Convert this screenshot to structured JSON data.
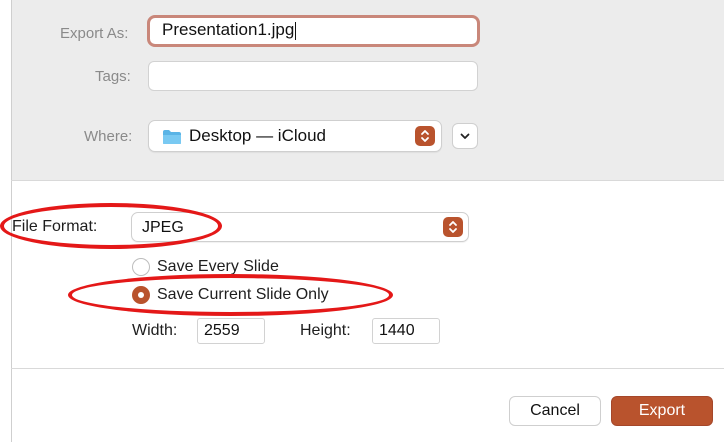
{
  "export_as": {
    "label": "Export As:",
    "value": "Presentation1.jpg"
  },
  "tags": {
    "label": "Tags:",
    "value": ""
  },
  "where": {
    "label": "Where:",
    "value": "Desktop — iCloud"
  },
  "file_format": {
    "label": "File Format:",
    "value": "JPEG"
  },
  "options": {
    "save_every": "Save Every Slide",
    "save_current": "Save Current Slide Only",
    "selected": "save_current"
  },
  "dimensions": {
    "width_label": "Width:",
    "width_value": "2559",
    "height_label": "Height:",
    "height_value": "1440"
  },
  "buttons": {
    "cancel": "Cancel",
    "export": "Export"
  },
  "colors": {
    "accent": "#b9532d",
    "annotation": "#e41818",
    "focus_ring": "#c9877a"
  }
}
